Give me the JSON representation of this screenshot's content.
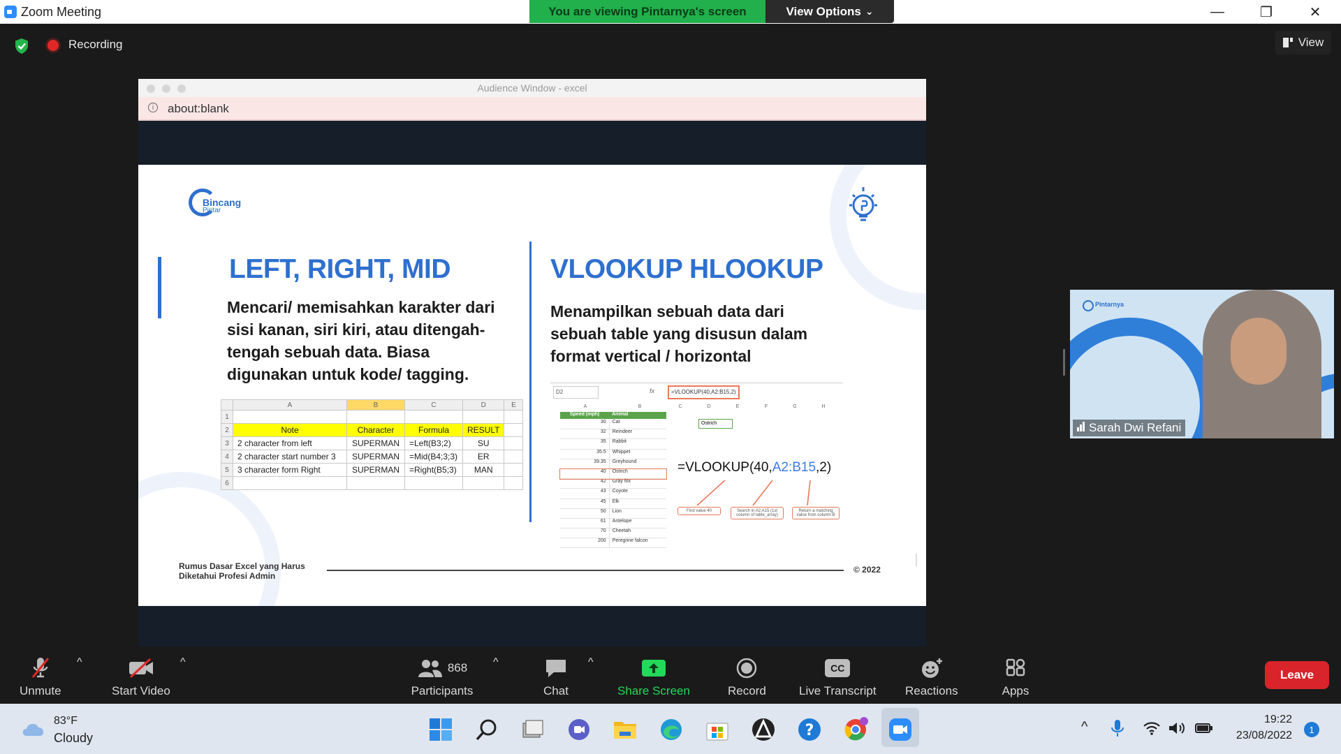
{
  "window": {
    "title": "Zoom Meeting",
    "viewing_banner": "You are viewing Pintarnya's screen",
    "view_options": "View Options",
    "view_options_caret": "⌄",
    "minimize": "—",
    "maximize": "❐",
    "close": "✕"
  },
  "meeting_header": {
    "recording_label": "Recording",
    "view_label": "View"
  },
  "shared_screen": {
    "audience_title": "Audience Window - excel",
    "url": "about:blank",
    "slide": {
      "logo_text_1": "Bincang",
      "logo_text_2": "Pintar",
      "left_heading": "LEFT, RIGHT, MID",
      "left_body": [
        "Mencari/ memisahkan karakter dari",
        "sisi kanan, siri kiri, atau ditengah-",
        "tengah sebuah data. Biasa",
        "digunakan untuk kode/ tagging."
      ],
      "right_heading": "VLOOKUP HLOOKUP",
      "right_body": [
        "Menampilkan sebuah data dari",
        "sebuah table yang disusun dalam",
        "format vertical / horizontal"
      ],
      "left_table": {
        "col_letters": [
          "A",
          "B",
          "C",
          "D",
          "E"
        ],
        "headers": [
          "Note",
          "Character",
          "Formula",
          "RESULT"
        ],
        "rows": [
          [
            "2 character from left",
            "SUPERMAN",
            "=Left(B3;2)",
            "SU"
          ],
          [
            "2 character start number 3",
            "SUPERMAN",
            "=Mid(B4;3;3)",
            "ER"
          ],
          [
            "3 character form Right",
            "SUPERMAN",
            "=Right(B5;3)",
            "MAN"
          ]
        ],
        "row_numbers": [
          "1",
          "2",
          "3",
          "4",
          "5",
          "6"
        ]
      },
      "vlookup": {
        "cell_ref": "D2",
        "formula_bar": "=VLOOKUP(40,A2:B15,2)",
        "fx": "fx",
        "col_letters": [
          "A",
          "B",
          "C",
          "D",
          "E",
          "F",
          "G",
          "H"
        ],
        "header_speed": "Speed (mph)",
        "header_animal": "Animal",
        "result_cell": "Ostrich",
        "rows": [
          [
            "30",
            "Cat"
          ],
          [
            "32",
            "Reindeer"
          ],
          [
            "35",
            "Rabbit"
          ],
          [
            "35.5",
            "Whippet"
          ],
          [
            "39.35",
            "Greyhound"
          ],
          [
            "40",
            "Ostrich"
          ],
          [
            "42",
            "Gray fox"
          ],
          [
            "43",
            "Coyote"
          ],
          [
            "45",
            "Elk"
          ],
          [
            "50",
            "Lion"
          ],
          [
            "61",
            "Antelope"
          ],
          [
            "70",
            "Cheetah"
          ],
          [
            "200",
            "Peregrine falcon"
          ]
        ],
        "big_formula_prefix": "=VLOOKUP(40,",
        "big_formula_range": "A2:B15",
        "big_formula_suffix": ",2)",
        "callout_1": "Find value 40",
        "callout_2": "Search in A2:A15 (1st column of table_array)",
        "callout_3": "Return a matching value from column B"
      },
      "footer_left_1": "Rumus Dasar Excel yang Harus",
      "footer_left_2": "Diketahui Profesi Admin",
      "footer_right": "© 2022"
    }
  },
  "participant_video": {
    "name": "Sarah Dwi Refani",
    "brand": "Pintarnya"
  },
  "toolbar": {
    "unmute": "Unmute",
    "start_video": "Start Video",
    "participants": "Participants",
    "participant_count": "868",
    "chat": "Chat",
    "share_screen": "Share Screen",
    "record": "Record",
    "live_transcript": "Live Transcript",
    "cc": "CC",
    "reactions": "Reactions",
    "apps": "Apps",
    "leave": "Leave",
    "caret": "^"
  },
  "taskbar": {
    "weather_temp": "83°F",
    "weather_desc": "Cloudy",
    "time": "19:22",
    "date": "23/08/2022",
    "notification_count": "1",
    "chevron": "^"
  },
  "colors": {
    "zoom_blue": "#2D8CFF",
    "banner_green": "#21b04b",
    "share_green": "#23d959",
    "leave_red": "#d9242b",
    "slide_heading_blue": "#2e6fcf"
  }
}
